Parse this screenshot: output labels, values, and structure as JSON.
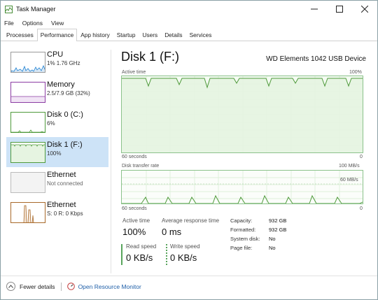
{
  "window": {
    "title": "Task Manager"
  },
  "menu": {
    "file": "File",
    "options": "Options",
    "view": "View"
  },
  "tabs": [
    "Processes",
    "Performance",
    "App history",
    "Startup",
    "Users",
    "Details",
    "Services"
  ],
  "active_tab": "Performance",
  "sidebar": [
    {
      "label": "CPU",
      "sub": "1% 1.76 GHz",
      "color": "#1b7fd1"
    },
    {
      "label": "Memory",
      "sub": "2.5/7.9 GB (32%)",
      "color": "#8b3ca3"
    },
    {
      "label": "Disk 0 (C:)",
      "sub": "6%",
      "color": "#4f9a3b"
    },
    {
      "label": "Disk 1 (F:)",
      "sub": "100%",
      "color": "#4f9a3b",
      "selected": true
    },
    {
      "label": "Ethernet",
      "sub": "Not connected",
      "color": "#a8692a"
    },
    {
      "label": "Ethernet",
      "sub": "S: 0 R: 0 Kbps",
      "color": "#a8692a"
    }
  ],
  "main": {
    "title": "Disk 1 (F:)",
    "device": "WD Elements 1042 USB Device",
    "graph1": {
      "label": "Active time",
      "max": "100%",
      "left": "60 seconds",
      "right": "0"
    },
    "graph2": {
      "label": "Disk transfer rate",
      "max": "100 MB/s",
      "right_label": "60 MB/s",
      "left": "60 seconds",
      "right": "0"
    }
  },
  "stats": {
    "active_time_label": "Active time",
    "active_time_value": "100%",
    "avg_resp_label": "Average response time",
    "avg_resp_value": "0 ms",
    "read_speed_label": "Read speed",
    "read_speed_value": "0 KB/s",
    "write_speed_label": "Write speed",
    "write_speed_value": "0 KB/s",
    "capacity_key": "Capacity:",
    "capacity_val": "932 GB",
    "formatted_key": "Formatted:",
    "formatted_val": "932 GB",
    "system_disk_key": "System disk:",
    "system_disk_val": "No",
    "page_file_key": "Page file:",
    "page_file_val": "No"
  },
  "footer": {
    "fewer": "Fewer details",
    "orm": "Open Resource Monitor"
  },
  "colors": {
    "disk_line": "#4f9a3b",
    "disk_fill": "#e6f4e1",
    "grid": "#cfe7cb"
  }
}
